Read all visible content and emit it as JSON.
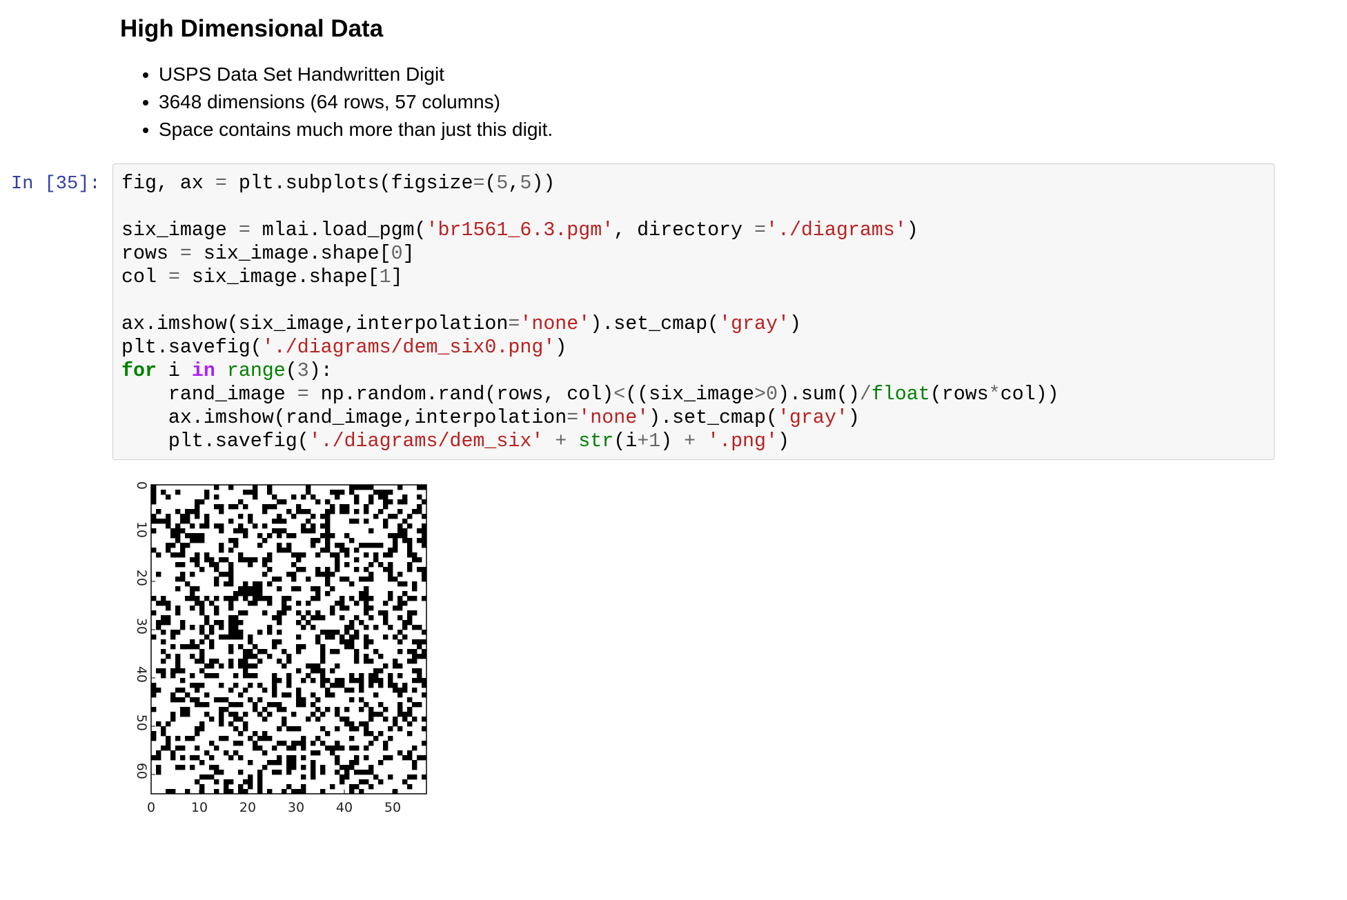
{
  "markdown": {
    "heading": "High Dimensional Data",
    "bullets": [
      "USPS Data Set Handwritten Digit",
      "3648 dimensions (64 rows, 57 columns)",
      "Space contains much more than just this digit."
    ]
  },
  "cell": {
    "prompt": "In [35]:",
    "code_lines": [
      "fig, ax = plt.subplots(figsize=(5,5))",
      "",
      "six_image = mlai.load_pgm('br1561_6.3.pgm', directory ='./diagrams')",
      "rows = six_image.shape[0]",
      "col = six_image.shape[1]",
      "",
      "ax.imshow(six_image,interpolation='none').set_cmap('gray')",
      "plt.savefig('./diagrams/dem_six0.png')",
      "for i in range(3):",
      "    rand_image = np.random.rand(rows, col)<((six_image>0).sum()/float(rows*col))",
      "    ax.imshow(rand_image,interpolation='none').set_cmap('gray')",
      "    plt.savefig('./diagrams/dem_six' + str(i+1) + '.png')"
    ]
  },
  "chart_data": {
    "type": "heatmap",
    "title": "",
    "xlabel": "",
    "ylabel": "",
    "rows": 64,
    "cols": 57,
    "x_ticks": [
      "0",
      "10",
      "20",
      "30",
      "40",
      "50"
    ],
    "y_ticks": [
      "0",
      "10",
      "20",
      "30",
      "40",
      "50",
      "60"
    ],
    "colormap": "gray",
    "colors": {
      "on": "#000000",
      "off": "#ffffff"
    },
    "fill_fraction": 0.3,
    "seed": 35
  }
}
